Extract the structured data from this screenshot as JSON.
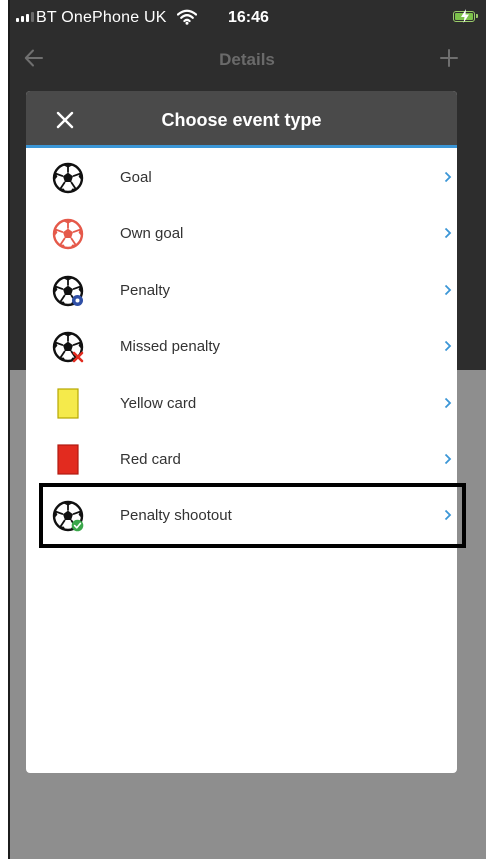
{
  "status_bar": {
    "carrier": "BT OnePhone UK",
    "time": "16:46"
  },
  "nav": {
    "title": "Details",
    "back_icon": "arrow-left-icon",
    "add_icon": "plus-icon"
  },
  "modal": {
    "title": "Choose event type",
    "close_icon": "close-icon",
    "items": [
      {
        "label": "Goal",
        "icon": "football-icon"
      },
      {
        "label": "Own goal",
        "icon": "football-red-icon"
      },
      {
        "label": "Penalty",
        "icon": "football-penalty-icon"
      },
      {
        "label": "Missed penalty",
        "icon": "football-missed-icon"
      },
      {
        "label": "Yellow card",
        "icon": "yellow-card-icon"
      },
      {
        "label": "Red card",
        "icon": "red-card-icon"
      },
      {
        "label": "Penalty shootout",
        "icon": "football-shootout-icon"
      }
    ]
  },
  "colors": {
    "accent": "#3b96d6",
    "header": "#4a4a4a",
    "yellow_card": "#f5ea4b",
    "red_card": "#e22b1f",
    "own_goal": "#e5594a",
    "shootout_check": "#3aa74a",
    "chevron": "#3b96d6"
  }
}
